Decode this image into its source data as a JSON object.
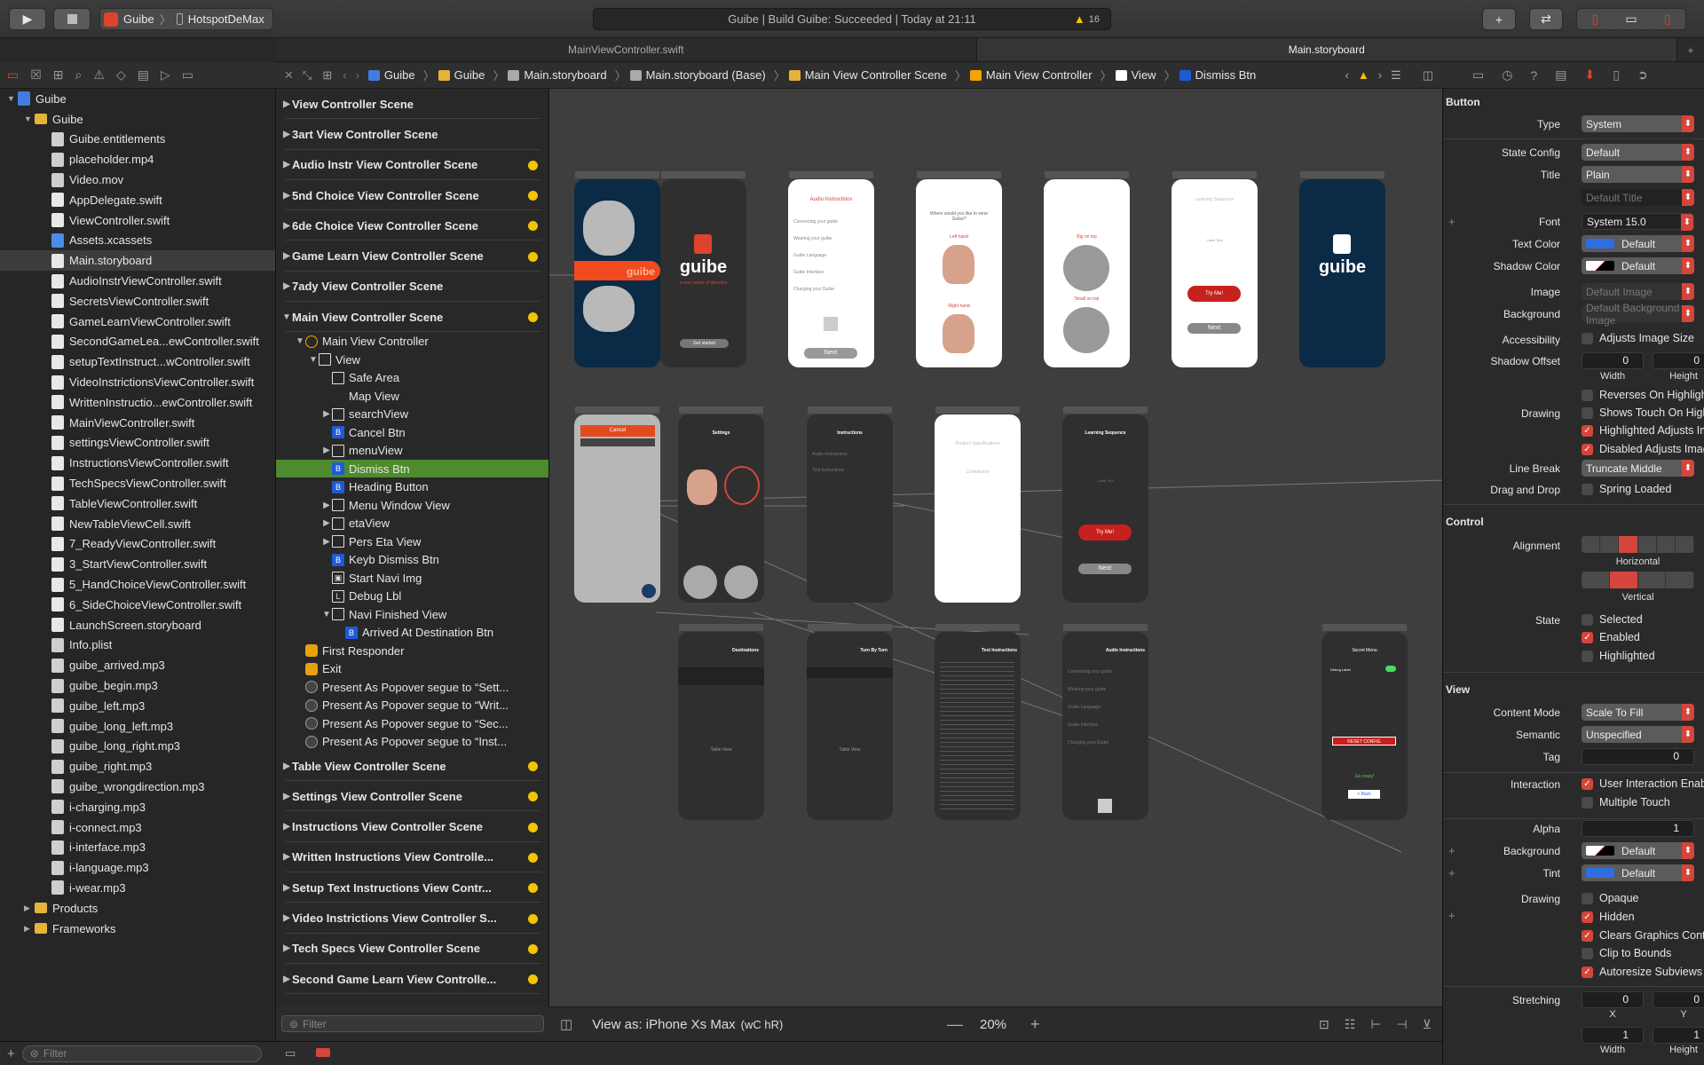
{
  "toolbar": {
    "scheme_app": "Guibe",
    "scheme_device": "HotspotDeMax",
    "activity": "Guibe | Build Guibe: Succeeded | Today at 21:11",
    "warning_count": "16"
  },
  "tabs": [
    "MainViewController.swift",
    "Main.storyboard"
  ],
  "navigator": {
    "items": [
      {
        "label": "Guibe",
        "depth": 0,
        "icon": "project",
        "tri": "▼"
      },
      {
        "label": "Guibe",
        "depth": 1,
        "icon": "folder",
        "tri": "▼"
      },
      {
        "label": "Guibe.entitlements",
        "depth": 2,
        "icon": "file"
      },
      {
        "label": "placeholder.mp4",
        "depth": 2,
        "icon": "file"
      },
      {
        "label": "Video.mov",
        "depth": 2,
        "icon": "file"
      },
      {
        "label": "AppDelegate.swift",
        "depth": 2,
        "icon": "swift"
      },
      {
        "label": "ViewController.swift",
        "depth": 2,
        "icon": "swift"
      },
      {
        "label": "Assets.xcassets",
        "depth": 2,
        "icon": "assets"
      },
      {
        "label": "Main.storyboard",
        "depth": 2,
        "icon": "storyboard",
        "sel": true
      },
      {
        "label": "AudioInstrViewController.swift",
        "depth": 2,
        "icon": "swift"
      },
      {
        "label": "SecretsViewController.swift",
        "depth": 2,
        "icon": "swift"
      },
      {
        "label": "GameLearnViewController.swift",
        "depth": 2,
        "icon": "swift"
      },
      {
        "label": "SecondGameLea...ewController.swift",
        "depth": 2,
        "icon": "swift"
      },
      {
        "label": "setupTextInstruct...wController.swift",
        "depth": 2,
        "icon": "swift"
      },
      {
        "label": "VideoInstrictionsViewController.swift",
        "depth": 2,
        "icon": "swift"
      },
      {
        "label": "WrittenInstructio...ewController.swift",
        "depth": 2,
        "icon": "swift"
      },
      {
        "label": "MainViewController.swift",
        "depth": 2,
        "icon": "swift"
      },
      {
        "label": "settingsViewController.swift",
        "depth": 2,
        "icon": "swift"
      },
      {
        "label": "InstructionsViewController.swift",
        "depth": 2,
        "icon": "swift"
      },
      {
        "label": "TechSpecsViewController.swift",
        "depth": 2,
        "icon": "swift"
      },
      {
        "label": "TableViewController.swift",
        "depth": 2,
        "icon": "swift"
      },
      {
        "label": "NewTableViewCell.swift",
        "depth": 2,
        "icon": "swift"
      },
      {
        "label": "7_ReadyViewController.swift",
        "depth": 2,
        "icon": "swift"
      },
      {
        "label": "3_StartViewController.swift",
        "depth": 2,
        "icon": "swift"
      },
      {
        "label": "5_HandChoiceViewController.swift",
        "depth": 2,
        "icon": "swift"
      },
      {
        "label": "6_SideChoiceViewController.swift",
        "depth": 2,
        "icon": "swift"
      },
      {
        "label": "LaunchScreen.storyboard",
        "depth": 2,
        "icon": "storyboard"
      },
      {
        "label": "Info.plist",
        "depth": 2,
        "icon": "file"
      },
      {
        "label": "guibe_arrived.mp3",
        "depth": 2,
        "icon": "file"
      },
      {
        "label": "guibe_begin.mp3",
        "depth": 2,
        "icon": "file"
      },
      {
        "label": "guibe_left.mp3",
        "depth": 2,
        "icon": "file"
      },
      {
        "label": "guibe_long_left.mp3",
        "depth": 2,
        "icon": "file"
      },
      {
        "label": "guibe_long_right.mp3",
        "depth": 2,
        "icon": "file"
      },
      {
        "label": "guibe_right.mp3",
        "depth": 2,
        "icon": "file"
      },
      {
        "label": "guibe_wrongdirection.mp3",
        "depth": 2,
        "icon": "file"
      },
      {
        "label": "i-charging.mp3",
        "depth": 2,
        "icon": "file"
      },
      {
        "label": "i-connect.mp3",
        "depth": 2,
        "icon": "file"
      },
      {
        "label": "i-interface.mp3",
        "depth": 2,
        "icon": "file"
      },
      {
        "label": "i-language.mp3",
        "depth": 2,
        "icon": "file"
      },
      {
        "label": "i-wear.mp3",
        "depth": 2,
        "icon": "file"
      },
      {
        "label": "Products",
        "depth": 1,
        "icon": "folder",
        "tri": "▶"
      },
      {
        "label": "Frameworks",
        "depth": 1,
        "icon": "folder",
        "tri": "▶"
      }
    ],
    "filter_placeholder": "Filter"
  },
  "jumpbar": [
    "Guibe",
    "Guibe",
    "Main.storyboard",
    "Main.storyboard (Base)",
    "Main View Controller Scene",
    "Main View Controller",
    "View",
    "Dismiss Btn"
  ],
  "outline": {
    "rows": [
      {
        "t": "View Controller Scene",
        "d": 0,
        "scene": true,
        "tri": "▶"
      },
      {
        "t": "3art View Controller Scene",
        "d": 0,
        "scene": true,
        "tri": "▶"
      },
      {
        "t": "Audio Instr View Controller Scene",
        "d": 0,
        "scene": true,
        "tri": "▶",
        "badge": true
      },
      {
        "t": "5nd Choice View Controller Scene",
        "d": 0,
        "scene": true,
        "tri": "▶",
        "badge": true
      },
      {
        "t": "6de Choice View Controller Scene",
        "d": 0,
        "scene": true,
        "tri": "▶",
        "badge": true
      },
      {
        "t": "Game Learn View Controller Scene",
        "d": 0,
        "scene": true,
        "tri": "▶",
        "badge": true
      },
      {
        "t": "7ady View Controller Scene",
        "d": 0,
        "scene": true,
        "tri": "▶"
      },
      {
        "t": "Main View Controller Scene",
        "d": 0,
        "scene": true,
        "tri": "▼",
        "badge": true
      },
      {
        "t": "Main View Controller",
        "d": 1,
        "tri": "▼",
        "icon": "orange"
      },
      {
        "t": "View",
        "d": 2,
        "tri": "▼",
        "icon": "box"
      },
      {
        "t": "Safe Area",
        "d": 3,
        "icon": "box"
      },
      {
        "t": "Map View",
        "d": 3,
        "icon": "none"
      },
      {
        "t": "searchView",
        "d": 3,
        "tri": "▶",
        "icon": "box"
      },
      {
        "t": "Cancel Btn",
        "d": 3,
        "icon": "B"
      },
      {
        "t": "menuView",
        "d": 3,
        "tri": "▶",
        "icon": "box"
      },
      {
        "t": "Dismiss Btn",
        "d": 3,
        "icon": "B",
        "sel": true
      },
      {
        "t": "Heading Button",
        "d": 3,
        "icon": "B"
      },
      {
        "t": "Menu Window View",
        "d": 3,
        "tri": "▶",
        "icon": "box"
      },
      {
        "t": "etaView",
        "d": 3,
        "tri": "▶",
        "icon": "box"
      },
      {
        "t": "Pers Eta View",
        "d": 3,
        "tri": "▶",
        "icon": "box"
      },
      {
        "t": "Keyb Dismiss Btn",
        "d": 3,
        "icon": "B"
      },
      {
        "t": "Start Navi Img",
        "d": 3,
        "icon": "img"
      },
      {
        "t": "Debug Lbl",
        "d": 3,
        "icon": "L"
      },
      {
        "t": "Navi Finished View",
        "d": 3,
        "tri": "▼",
        "icon": "box"
      },
      {
        "t": "Arrived At Destination Btn",
        "d": 4,
        "icon": "B"
      },
      {
        "t": "First Responder",
        "d": 1,
        "icon": "yel"
      },
      {
        "t": "Exit",
        "d": 1,
        "icon": "yel"
      },
      {
        "t": "Present As Popover segue to “Sett...",
        "d": 1,
        "icon": "circ"
      },
      {
        "t": "Present As Popover segue to “Writ...",
        "d": 1,
        "icon": "circ"
      },
      {
        "t": "Present As Popover segue to “Sec...",
        "d": 1,
        "icon": "circ"
      },
      {
        "t": "Present As Popover segue to “Inst...",
        "d": 1,
        "icon": "circ"
      },
      {
        "t": "Table View Controller Scene",
        "d": 0,
        "scene": true,
        "tri": "▶",
        "badge": true
      },
      {
        "t": "Settings View Controller Scene",
        "d": 0,
        "scene": true,
        "tri": "▶",
        "badge": true
      },
      {
        "t": "Instructions View Controller Scene",
        "d": 0,
        "scene": true,
        "tri": "▶",
        "badge": true
      },
      {
        "t": "Written Instructions View Controlle...",
        "d": 0,
        "scene": true,
        "tri": "▶",
        "badge": true
      },
      {
        "t": "Setup Text Instructions View Contr...",
        "d": 0,
        "scene": true,
        "tri": "▶",
        "badge": true
      },
      {
        "t": "Video Instrictions View Controller S...",
        "d": 0,
        "scene": true,
        "tri": "▶",
        "badge": true
      },
      {
        "t": "Tech Specs View Controller Scene",
        "d": 0,
        "scene": true,
        "tri": "▶",
        "badge": true
      },
      {
        "t": "Second Game Learn View Controlle...",
        "d": 0,
        "scene": true,
        "tri": "▶",
        "badge": true
      }
    ],
    "filter_placeholder": "Filter"
  },
  "canvas": {
    "view_as": "View as: iPhone Xs Max",
    "size_class": "(wC hR)",
    "zoom": "20%",
    "texts": {
      "guibe": "guibe",
      "audio_instructions": "Audio Instructions",
      "next": "Next",
      "where": "Where would you like to wear Guibe?",
      "left_hand": "Left hand",
      "right_hand": "Right hand",
      "big_on_top": "Big on top",
      "small_on_top": "Small on top",
      "learning_sequence": "Learning Sequence",
      "label_text": "Label Text",
      "try_me": "Try Me!",
      "cancel": "Cancel",
      "settings": "Settings",
      "instructions": "Instructions",
      "destinations": "Destinations",
      "turn_by_turn": "Turn By Turn",
      "text_instructions": "Text Instructions",
      "table_view": "Table View",
      "secret_menu": "Secret Menu",
      "debug_label": "Debug Label",
      "reset_config": "RESET CONFIG",
      "go_crazy": "Go crazy!",
      "back": "< Back",
      "get_started": "Get started",
      "a_new_sense": "a new sense of direction",
      "connecting": "Connecting your guibe",
      "wearing": "Wearing your guibe",
      "language": "Guibe Language",
      "interface": "Guibe Interface",
      "charging": "Charging your Guibe",
      "product_specs": "Product Specifications",
      "compliance": "Compliance",
      "audio_instr": "Audio Instructions",
      "text_instr": "Text Instructions"
    }
  },
  "inspector": {
    "button_header": "Button",
    "type": "System",
    "state_config": "Default",
    "title": "Plain",
    "default_title": "Default Title",
    "font": "System 15.0",
    "text_color": "Default",
    "shadow_color": "Default",
    "image": "Default Image",
    "background": "Default Background Image",
    "accessibility": "Adjusts Image Size",
    "shadow_offset_w": "0",
    "shadow_offset_h": "0",
    "width_lbl": "Width",
    "height_lbl": "Height",
    "reverses": "Reverses On Highlight",
    "shows_touch": "Shows Touch On Highlight",
    "highlighted_adjusts": "Highlighted Adjusts Image",
    "disabled_adjusts": "Disabled Adjusts Image",
    "line_break": "Truncate Middle",
    "drag_drop": "Spring Loaded",
    "control_header": "Control",
    "horizontal": "Horizontal",
    "vertical": "Vertical",
    "state_selected": "Selected",
    "state_enabled": "Enabled",
    "state_highlighted": "Highlighted",
    "view_header": "View",
    "content_mode": "Scale To Fill",
    "semantic": "Unspecified",
    "tag": "0",
    "user_interaction": "User Interaction Enabled",
    "multiple_touch": "Multiple Touch",
    "alpha": "1",
    "background_color": "Default",
    "tint": "Default",
    "opaque": "Opaque",
    "hidden": "Hidden",
    "clears": "Clears Graphics Context",
    "clip": "Clip to Bounds",
    "autoresize": "Autoresize Subviews",
    "stretch_x": "0",
    "stretch_y": "0",
    "stretch_w": "1",
    "stretch_h": "1",
    "x_lbl": "X",
    "y_lbl": "Y",
    "labels": {
      "type": "Type",
      "state_config": "State Config",
      "title": "Title",
      "font": "Font",
      "text_color": "Text Color",
      "shadow_color": "Shadow Color",
      "image": "Image",
      "background": "Background",
      "accessibility": "Accessibility",
      "shadow_offset": "Shadow Offset",
      "drawing": "Drawing",
      "line_break": "Line Break",
      "drag_drop": "Drag and Drop",
      "alignment": "Alignment",
      "state": "State",
      "content_mode": "Content Mode",
      "semantic": "Semantic",
      "tag": "Tag",
      "interaction": "Interaction",
      "alpha": "Alpha",
      "tint": "Tint",
      "drawing2": "Drawing",
      "stretching": "Stretching"
    }
  },
  "colors": {
    "accent_red": "#d4463b",
    "selection_green": "#4e8b2f",
    "guibe_navy": "#0b2a45",
    "guibe_orange": "#f04a1e",
    "warning": "#f2c500"
  }
}
